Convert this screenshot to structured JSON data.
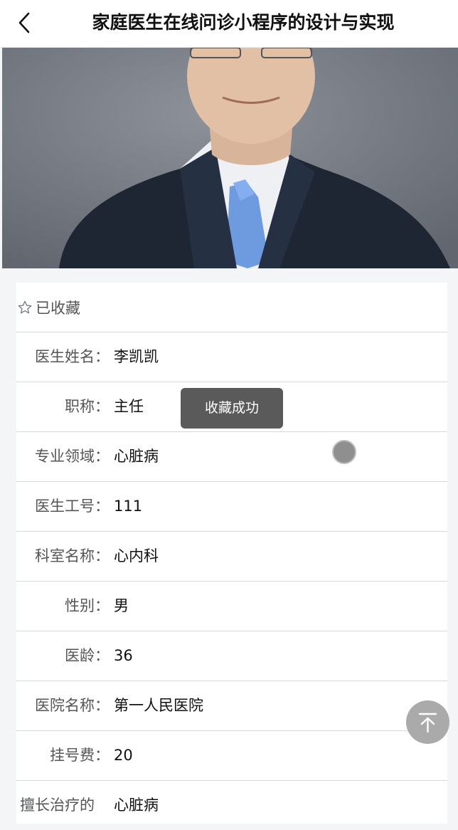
{
  "header": {
    "title": "家庭医生在线问诊小程序的设计与实现",
    "back_icon": "chevron-left-icon"
  },
  "favorite": {
    "icon": "star-outline-icon",
    "label": "已收藏"
  },
  "details": [
    {
      "label": "医生姓名",
      "value": "李凯凯"
    },
    {
      "label": "职称",
      "value": "主任"
    },
    {
      "label": "专业领域",
      "value": "心脏病"
    },
    {
      "label": "医生工号",
      "value": "111"
    },
    {
      "label": "科室名称",
      "value": "心内科"
    },
    {
      "label": "性别",
      "value": "男"
    },
    {
      "label": "医龄",
      "value": "36"
    },
    {
      "label": "医院名称",
      "value": "第一人民医院"
    },
    {
      "label": "挂号费",
      "value": "20"
    },
    {
      "label": "擅长治疗的",
      "value": "心脏病"
    }
  ],
  "colon": "：",
  "toast": {
    "text": "收藏成功"
  },
  "scroll_top": {
    "icon": "arrow-up-to-top-icon"
  }
}
